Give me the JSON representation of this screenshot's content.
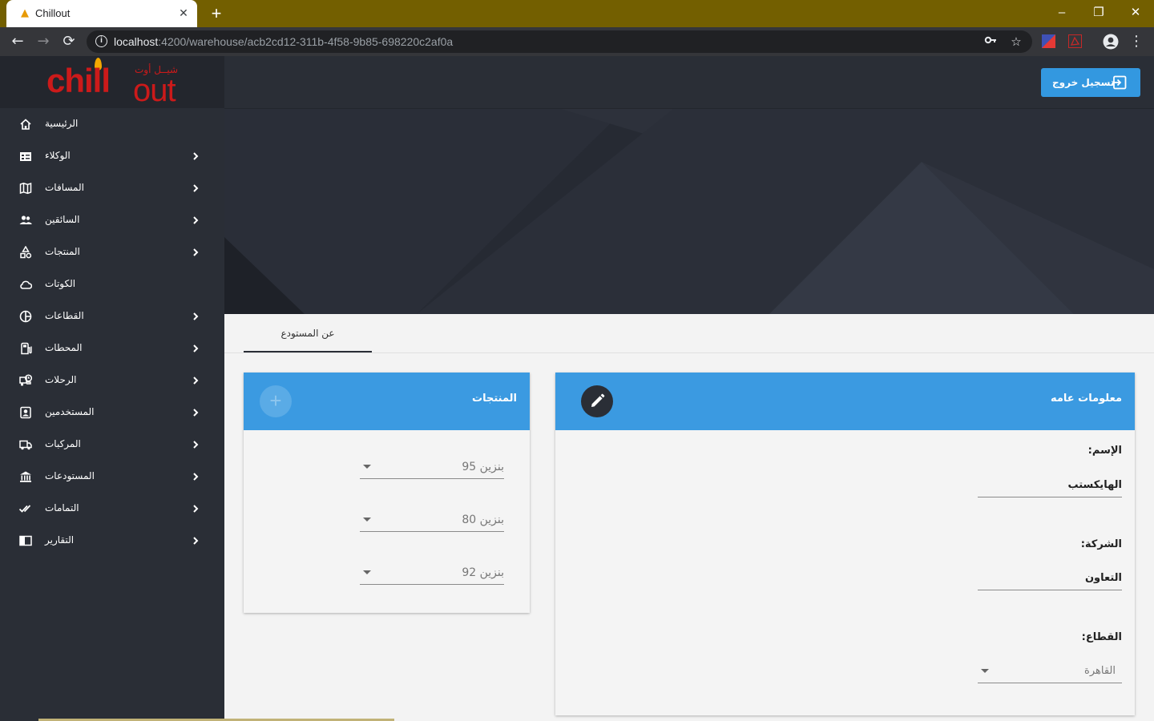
{
  "browser": {
    "tab_title": "Chillout",
    "url_host": "localhost",
    "url_rest": ":4200/warehouse/acb2cd12-311b-4f58-9b85-698220c2af0a",
    "new_tab": "+",
    "minimize": "–",
    "restore": "❐",
    "close_window": "✕",
    "close_tab": "✕"
  },
  "logo": {
    "word1": "chill",
    "word2": "out",
    "arabic": "شيــل أوت"
  },
  "sidebar": {
    "items": [
      {
        "label": "الرئيسية",
        "icon": "home-icon",
        "chevron": false
      },
      {
        "label": "الوكلاء",
        "icon": "agents-icon",
        "chevron": true
      },
      {
        "label": "المسافات",
        "icon": "map-icon",
        "chevron": true
      },
      {
        "label": "السائقين",
        "icon": "drivers-icon",
        "chevron": true
      },
      {
        "label": "المنتجات",
        "icon": "products-icon",
        "chevron": true
      },
      {
        "label": "الكوتات",
        "icon": "cloud-icon",
        "chevron": false
      },
      {
        "label": "القطاعات",
        "icon": "sectors-icon",
        "chevron": true
      },
      {
        "label": "المحطات",
        "icon": "stations-icon",
        "chevron": true
      },
      {
        "label": "الرحلات",
        "icon": "trips-icon",
        "chevron": true
      },
      {
        "label": "المستخدمين",
        "icon": "users-icon",
        "chevron": true
      },
      {
        "label": "المركبات",
        "icon": "truck-icon",
        "chevron": true
      },
      {
        "label": "المستودعات",
        "icon": "warehouse-icon",
        "chevron": true
      },
      {
        "label": "التمامات",
        "icon": "checks-icon",
        "chevron": true
      },
      {
        "label": "التقارير",
        "icon": "reports-icon",
        "chevron": true
      }
    ]
  },
  "topbar": {
    "logout_label": "تسجيل خروج"
  },
  "tabs": {
    "about_label": "عن المستودع"
  },
  "products_card": {
    "title": "المنتجات",
    "add": "+",
    "items": [
      "بنزين 95",
      "بنزين 80",
      "بنزين 92"
    ]
  },
  "info_card": {
    "title": "معلومات عامه",
    "name_label": "الإسم:",
    "name_value": "الهايكستب",
    "company_label": "الشركة:",
    "company_value": "التعاون",
    "sector_label": "القطاع:",
    "sector_value": "القاهرة"
  },
  "colors": {
    "accent": "#3b9ae1",
    "sidebar_bg": "#2a2e36",
    "browser_frame": "#735f00",
    "logo_red": "#cc1a1a"
  }
}
